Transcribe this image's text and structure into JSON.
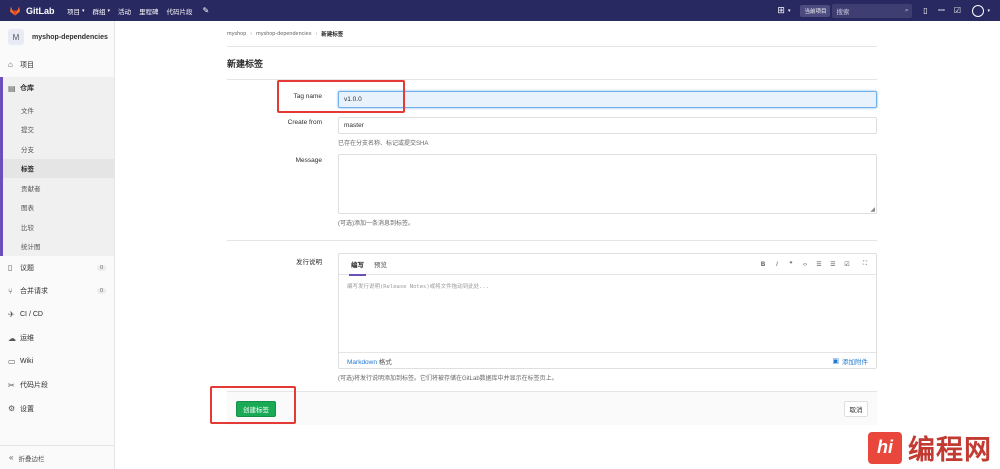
{
  "topnav": {
    "brand": "GitLab",
    "links": [
      {
        "label": "项目",
        "caret": true
      },
      {
        "label": "群组",
        "caret": true
      },
      {
        "label": "活动",
        "caret": false
      },
      {
        "label": "里程碑",
        "caret": false
      },
      {
        "label": "代码片段",
        "caret": false
      }
    ],
    "scope": "当前项目",
    "search_placeholder": "搜索"
  },
  "sidebar": {
    "project_initial": "M",
    "project_name": "myshop-dependencies",
    "items": [
      {
        "label": "项目"
      },
      {
        "label": "仓库"
      },
      {
        "label": "议题",
        "count": "0"
      },
      {
        "label": "合并请求",
        "count": "0"
      },
      {
        "label": "CI / CD"
      },
      {
        "label": "运维"
      },
      {
        "label": "Wiki"
      },
      {
        "label": "代码片段"
      },
      {
        "label": "设置"
      }
    ],
    "repo_sub": [
      "文件",
      "提交",
      "分支",
      "标签",
      "贡献者",
      "图表",
      "比较",
      "统计图"
    ],
    "collapse_label": "折叠边栏"
  },
  "breadcrumb": [
    "myshop",
    "myshop-dependencies",
    "新建标签"
  ],
  "page_title": "新建标签",
  "form": {
    "tag_name_label": "Tag name",
    "tag_name_value": "v1.0.0",
    "create_from_label": "Create from",
    "create_from_value": "master",
    "create_from_hint": "已存在分支名称、标记或提交SHA",
    "message_label": "Message",
    "message_hint": "(可选)添加一条消息到标签。",
    "release_label": "发行说明",
    "editor_tabs": [
      "编写",
      "预览"
    ],
    "editor_placeholder": "编写发行说明(Release Notes)或将文件拖动到此处...",
    "markdown_link": "Markdown",
    "markdown_suffix": " 格式",
    "attach_label": "添加附件",
    "release_hint": "(可选)将发行说明添加到标签。它们将被存储在GitLab数据库中并显示在标签页上。",
    "create_button": "创建标签",
    "cancel_button": "取消"
  },
  "watermark": {
    "logo_text": "hi",
    "text": "编程网"
  },
  "colors": {
    "nav": "#292961",
    "accent": "#6b4fbb",
    "create": "#1aaa55",
    "annotation": "#e53935"
  }
}
